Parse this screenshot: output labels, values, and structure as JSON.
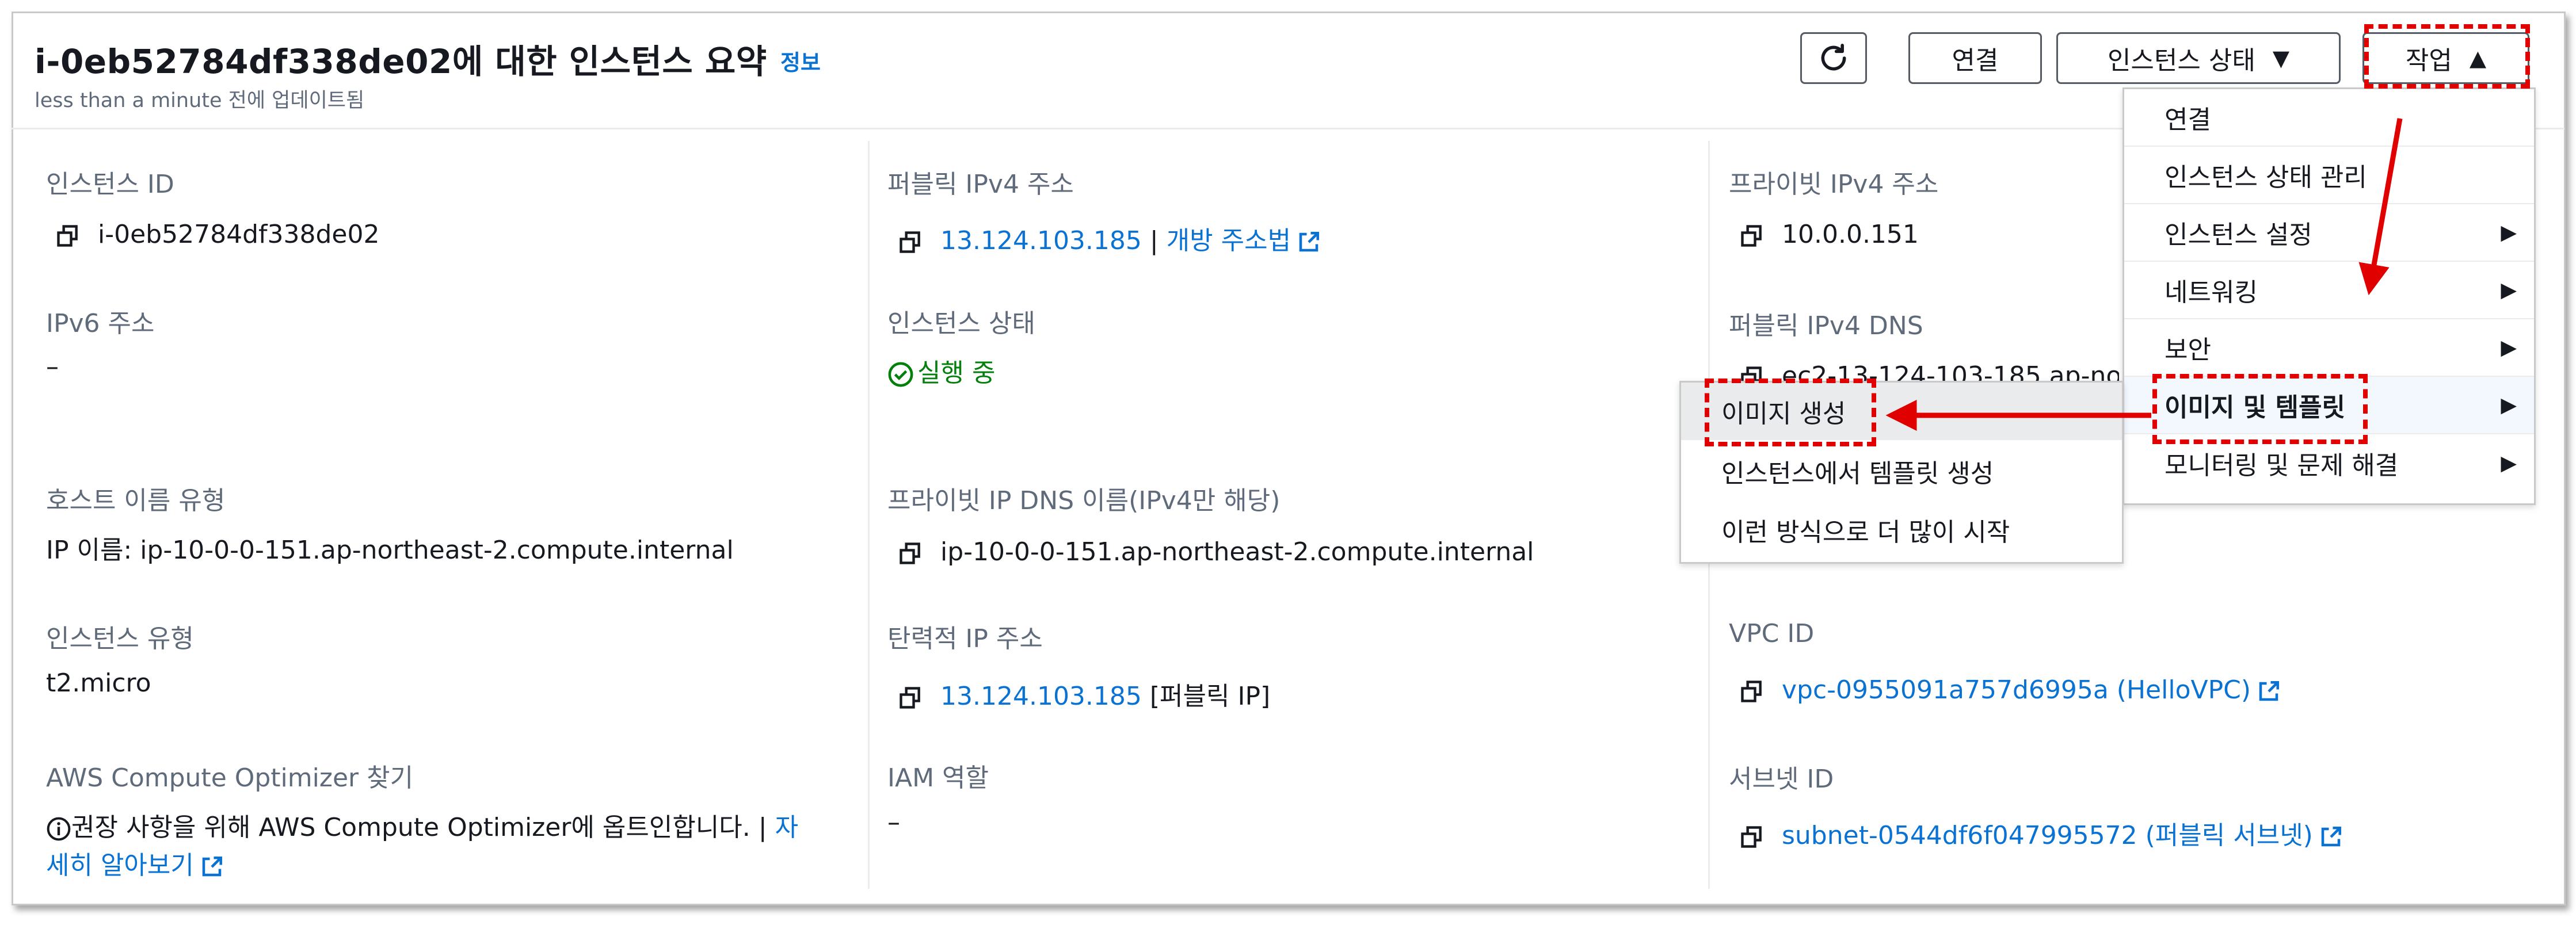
{
  "header": {
    "title": "i-0eb52784df338de02에 대한 인스턴스 요약",
    "info_link": "정보",
    "subtitle": "less than a minute 전에 업데이트됨"
  },
  "toolbar": {
    "refresh_icon": "refresh-icon",
    "connect_label": "연결",
    "instance_state_label": "인스턴스 상태",
    "actions_label": "작업"
  },
  "columns": {
    "col1": {
      "instance_id_label": "인스턴스 ID",
      "instance_id_value": "i-0eb52784df338de02",
      "ipv6_label": "IPv6 주소",
      "ipv6_value": "–",
      "hostname_type_label": "호스트 이름 유형",
      "hostname_type_value": "IP 이름: ip-10-0-0-151.ap-northeast-2.compute.internal",
      "instance_type_label": "인스턴스 유형",
      "instance_type_value": "t2.micro",
      "optimizer_label": "AWS Compute Optimizer 찾기",
      "optimizer_text_1": "권장 사항을 위해 AWS Compute Optimizer에 옵트인합니다. |",
      "optimizer_link_1": "자",
      "optimizer_link_2": "세히 알아보기"
    },
    "col2": {
      "public_ipv4_label": "퍼블릭 IPv4 주소",
      "public_ipv4_value": "13.124.103.185",
      "public_ipv4_sep": " | ",
      "open_address_link": "개방 주소법",
      "instance_state_label": "인스턴스 상태",
      "instance_state_value": "실행 중",
      "private_dns_label": "프라이빗 IP DNS 이름(IPv4만 해당)",
      "private_dns_value": "ip-10-0-0-151.ap-northeast-2.compute.internal",
      "elastic_ip_label": "탄력적 IP 주소",
      "elastic_ip_value": "13.124.103.185",
      "elastic_ip_suffix": " [퍼블릭 IP]",
      "iam_role_label": "IAM 역할",
      "iam_role_value": "–"
    },
    "col3": {
      "private_ipv4_label": "프라이빗 IPv4 주소",
      "private_ipv4_value": "10.0.0.151",
      "public_dns_label": "퍼블릭 IPv4 DNS",
      "public_dns_value": "ec2-13-124-103-185.ap-no",
      "vpc_label": "VPC ID",
      "vpc_value": "vpc-0955091a757d6995a (HelloVPC)",
      "subnet_label": "서브넷 ID",
      "subnet_value": "subnet-0544df6f047995572 (퍼블릭 서브넷)"
    }
  },
  "actions_menu": {
    "items": [
      {
        "label": "연결"
      },
      {
        "label": "인스턴스 상태 관리"
      },
      {
        "label": "인스턴스 설정"
      },
      {
        "label": "네트워킹"
      },
      {
        "label": "보안"
      },
      {
        "label": "이미지 및 템플릿"
      },
      {
        "label": "모니터링 및 문제 해결"
      }
    ]
  },
  "image_submenu": {
    "items": [
      {
        "label": "이미지 생성"
      },
      {
        "label": "인스턴스에서 템플릿 생성"
      },
      {
        "label": "이런 방식으로 더 많이 시작"
      }
    ]
  },
  "colors": {
    "link": "#0972d3",
    "success": "#037f0c",
    "annotation": "#e00000"
  }
}
